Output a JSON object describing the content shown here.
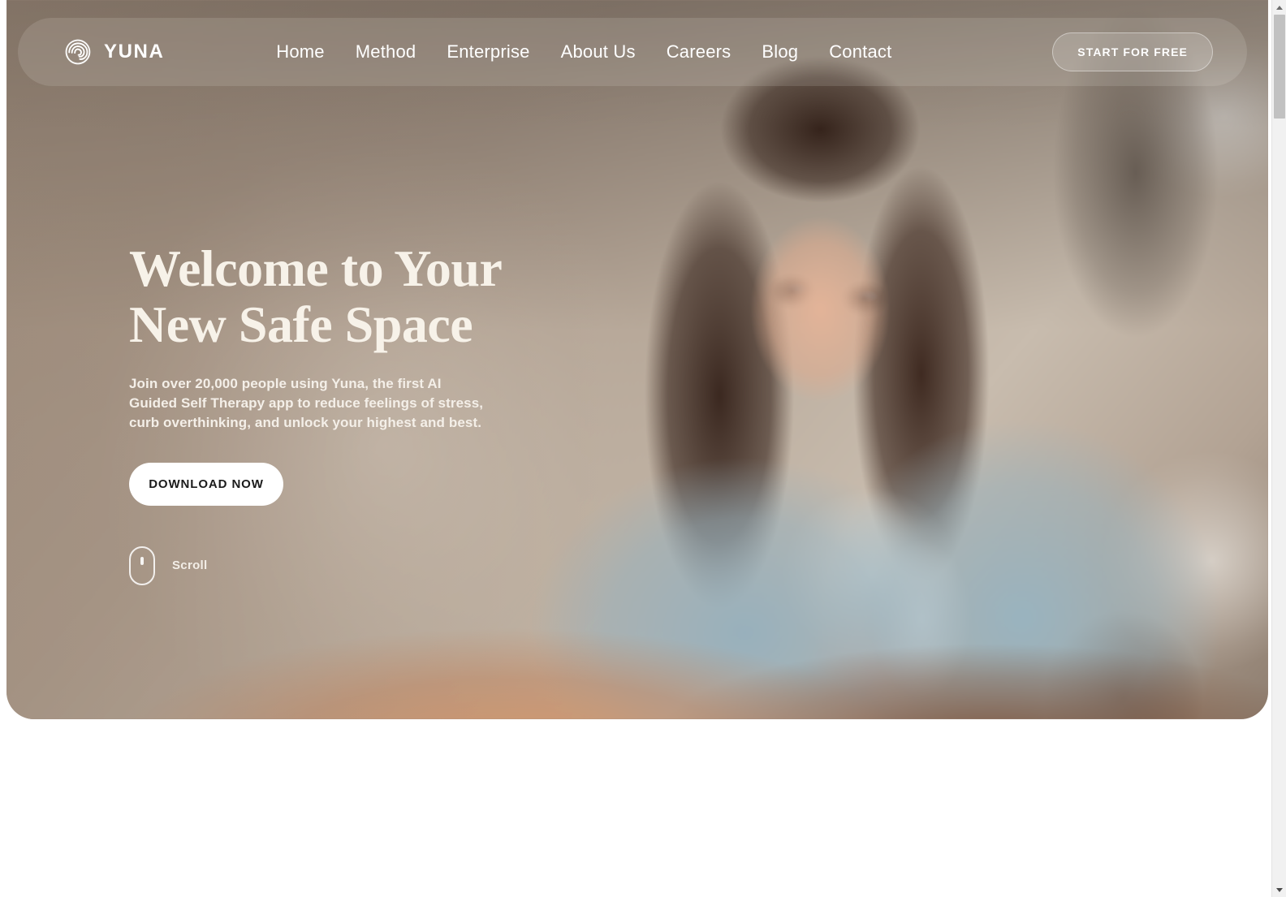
{
  "brand": {
    "name": "YUNA",
    "logo_icon": "spiral-swirl-icon"
  },
  "nav": {
    "links": [
      {
        "label": "Home"
      },
      {
        "label": "Method"
      },
      {
        "label": "Enterprise"
      },
      {
        "label": "About Us"
      },
      {
        "label": "Careers"
      },
      {
        "label": "Blog"
      },
      {
        "label": "Contact"
      }
    ],
    "cta_label": "START FOR FREE"
  },
  "hero": {
    "title": "Welcome to Your\nNew Safe Space",
    "subtitle": "Join over 20,000 people using Yuna, the first AI Guided Self Therapy app to reduce feelings of stress, curb overthinking, and unlock your highest and best.",
    "download_label": "DOWNLOAD NOW",
    "scroll_label": "Scroll",
    "scroll_icon": "mouse-icon"
  },
  "colors": {
    "hero_base": "#a79486",
    "title_cream": "#f7f2e9",
    "button_white": "#ffffff",
    "button_text": "#1b1b1b",
    "nav_text": "#ffffff",
    "page_background": "#ffffff",
    "scrollbar_track": "#f1f1f1",
    "scrollbar_thumb": "#c1c1c1"
  },
  "scrollbar": {
    "up_arrow_icon": "chevron-up-icon",
    "down_arrow_icon": "chevron-down-icon"
  }
}
